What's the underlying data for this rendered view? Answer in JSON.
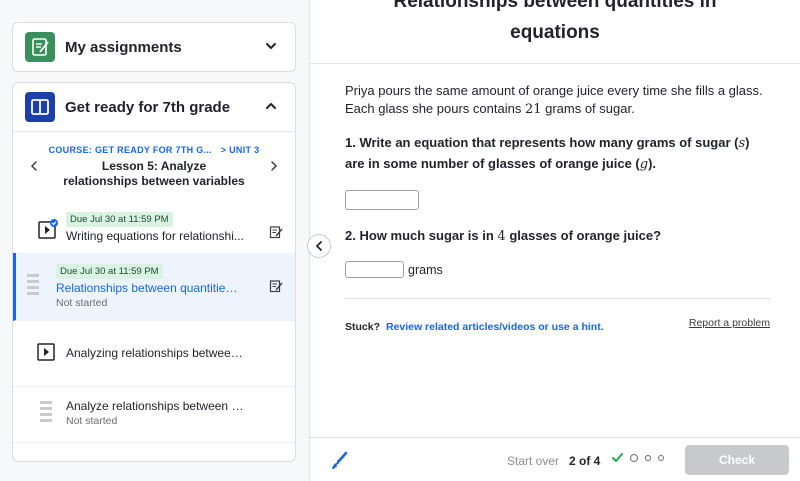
{
  "sidebar": {
    "assignments": {
      "title": "My assignments"
    },
    "course": {
      "title": "Get ready for 7th grade",
      "course_label": "COURSE: GET READY FOR 7TH G...",
      "unit_label": "> UNIT 3",
      "lesson_title": "Lesson 5: Analyze relationships between variables",
      "items": [
        {
          "due": "Due Jul 30 at 11:59 PM",
          "name": "Writing equations for relationshi...",
          "status": ""
        },
        {
          "due": "Due Jul 30 at 11:59 PM",
          "name": "Relationships between quantities...",
          "status": "Not started"
        },
        {
          "due": "",
          "name": "Analyzing relationships between va...",
          "status": ""
        },
        {
          "due": "",
          "name": "Analyze relationships between vari...",
          "status": "Not started"
        }
      ]
    }
  },
  "main": {
    "title_line1": "Relationships between quantities in",
    "title_line2": "equations",
    "problem_text_1": "Priya pours the same amount of orange juice every time she fills a glass. Each glass she pours contains ",
    "problem_number": "21",
    "problem_text_2": " grams of sugar.",
    "q1_text_1": "1. Write an equation that represents how many grams of sugar (",
    "q1_var_s": "s",
    "q1_text_2": ") are in some number of glasses of orange juice (",
    "q1_var_g": "g",
    "q1_text_3": ").",
    "q2_text_1": "2. How much sugar is in ",
    "q2_number": "4",
    "q2_text_2": " glasses of orange juice?",
    "q2_unit": "grams",
    "stuck_label": "Stuck?",
    "stuck_link": "Review related articles/videos or use a hint.",
    "report_link": "Report a problem"
  },
  "footer": {
    "start_over": "Start over",
    "progress": "2 of 4",
    "check": "Check"
  },
  "colors": {
    "accent": "#1865f2",
    "due_badge_bg": "#d9f2e2",
    "check_disabled": "#c7c9cc",
    "complete_check": "#1fab54",
    "assign_icon": "#3a8f5c",
    "course_icon": "#1c3fa8"
  }
}
